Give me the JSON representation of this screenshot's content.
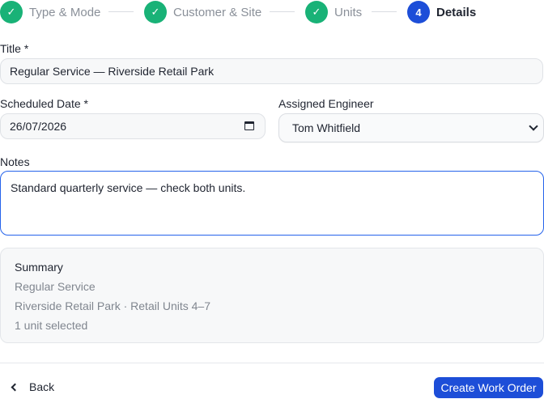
{
  "stepper": {
    "steps": [
      {
        "number": "",
        "label": "Type & Mode",
        "status": "done"
      },
      {
        "number": "",
        "label": "Customer & Site",
        "status": "done"
      },
      {
        "number": "",
        "label": "Units",
        "status": "done"
      },
      {
        "number": "4",
        "label": "Details",
        "status": "active"
      }
    ],
    "done_glyph": "✓"
  },
  "form": {
    "title": {
      "label": "Title *",
      "value": "Regular Service — Riverside Retail Park"
    },
    "scheduled_date": {
      "label": "Scheduled Date *",
      "value": "26/07/2026"
    },
    "assigned_engineer": {
      "label": "Assigned Engineer",
      "value": "Tom Whitfield"
    },
    "notes": {
      "label": "Notes",
      "value": "Standard quarterly service — check both units."
    }
  },
  "summary": {
    "title": "Summary",
    "lines": [
      "Regular Service",
      "Riverside Retail Park · Retail Units 4–7",
      "1 unit selected"
    ]
  },
  "footer": {
    "back_label": "Back",
    "create_label": "Create Work Order"
  },
  "colors": {
    "done": "#19b277",
    "active": "#1d4ed8",
    "primary": "#1d4ed8",
    "focus_border": "#2563eb"
  }
}
